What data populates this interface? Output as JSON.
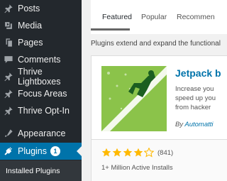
{
  "sidebar": {
    "items": [
      {
        "label": "Posts",
        "icon": "pin-icon"
      },
      {
        "label": "Media",
        "icon": "media-icon"
      },
      {
        "label": "Pages",
        "icon": "pages-icon"
      },
      {
        "label": "Comments",
        "icon": "comments-icon"
      },
      {
        "label": "Thrive Lightboxes",
        "icon": "pin-icon"
      },
      {
        "label": "Focus Areas",
        "icon": "pin-icon"
      },
      {
        "label": "Thrive Opt-In",
        "icon": "pin-icon"
      },
      {
        "label": "Appearance",
        "icon": "appearance-icon"
      },
      {
        "label": "Plugins",
        "icon": "plugins-icon",
        "badge": "1",
        "active": true
      }
    ],
    "submenu": {
      "label": "Installed Plugins"
    }
  },
  "main": {
    "tabs": [
      {
        "label": "Featured",
        "current": true
      },
      {
        "label": "Popular"
      },
      {
        "label": "Recommen"
      }
    ],
    "description": "Plugins extend and expand the functional",
    "card": {
      "title": "Jetpack b",
      "text_lines": [
        "Increase you",
        "speed up you",
        "from hacker"
      ],
      "by_prefix": "By",
      "author": "Automatti",
      "rating": 4,
      "rating_max": 5,
      "rating_count": "(841)",
      "installs": "1+ Million Active Installs"
    }
  },
  "colors": {
    "sidebar_bg": "#23282d",
    "active_bg": "#0073aa",
    "link": "#0073aa",
    "icon_bg": "#8bc34a",
    "star": "#ffb900"
  }
}
